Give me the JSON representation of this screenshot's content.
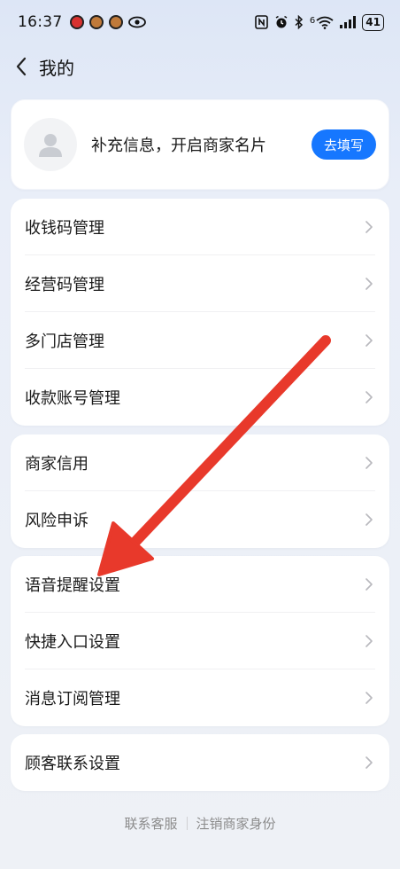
{
  "status_bar": {
    "time": "16:37",
    "battery": "41",
    "network": "6"
  },
  "nav": {
    "title": "我的"
  },
  "profile": {
    "prompt": "补充信息，开启商家名片",
    "button": "去填写"
  },
  "groups": [
    {
      "items": [
        "收钱码管理",
        "经营码管理",
        "多门店管理",
        "收款账号管理"
      ]
    },
    {
      "items": [
        "商家信用",
        "风险申诉"
      ]
    },
    {
      "items": [
        "语音提醒设置",
        "快捷入口设置",
        "消息订阅管理"
      ]
    },
    {
      "items": [
        "顾客联系设置"
      ]
    }
  ],
  "footer": {
    "contact": "联系客服",
    "cancel": "注销商家身份"
  },
  "colors": {
    "accent": "#1677ff",
    "annotation_arrow": "#e8392b"
  }
}
